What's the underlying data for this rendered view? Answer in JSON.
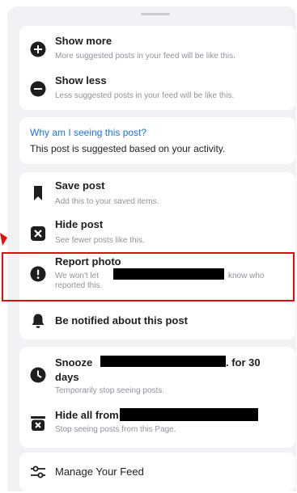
{
  "menu": {
    "show_more": {
      "title": "Show more",
      "subtitle": "More suggested posts in your feed will be like this."
    },
    "show_less": {
      "title": "Show less",
      "subtitle": "Less suggested posts in your feed will be like this."
    },
    "why": {
      "link": "Why am I seeing this post?",
      "text": "This post is suggested based on your activity."
    },
    "save_post": {
      "title": "Save post",
      "subtitle": "Add this to your saved items."
    },
    "hide_post": {
      "title": "Hide post",
      "subtitle": "See fewer posts like this."
    },
    "report_photo": {
      "title": "Report photo",
      "subtitle_start": "We won't let",
      "subtitle_end": "know who",
      "subtitle_line2": "reported this."
    },
    "notify": {
      "title": "Be notified about this post"
    },
    "snooze": {
      "title_start": "Snooze",
      "title_end": ". for 30",
      "title_line2": "days",
      "subtitle": "Temporarily stop seeing posts."
    },
    "hide_all": {
      "title_start": "Hide all from",
      "subtitle": "Stop seeing posts from this Page."
    },
    "manage_feed": {
      "title": "Manage Your Feed"
    }
  },
  "colors": {
    "link": "#1b74e4",
    "highlight": "#e10d0d",
    "background": "#f0f2f5"
  },
  "icons": [
    "plus-circle-icon",
    "minus-circle-icon",
    "bookmark-icon",
    "close-box-icon",
    "exclamation-circle-icon",
    "bell-icon",
    "clock-icon",
    "hide-all-icon",
    "sliders-icon"
  ]
}
